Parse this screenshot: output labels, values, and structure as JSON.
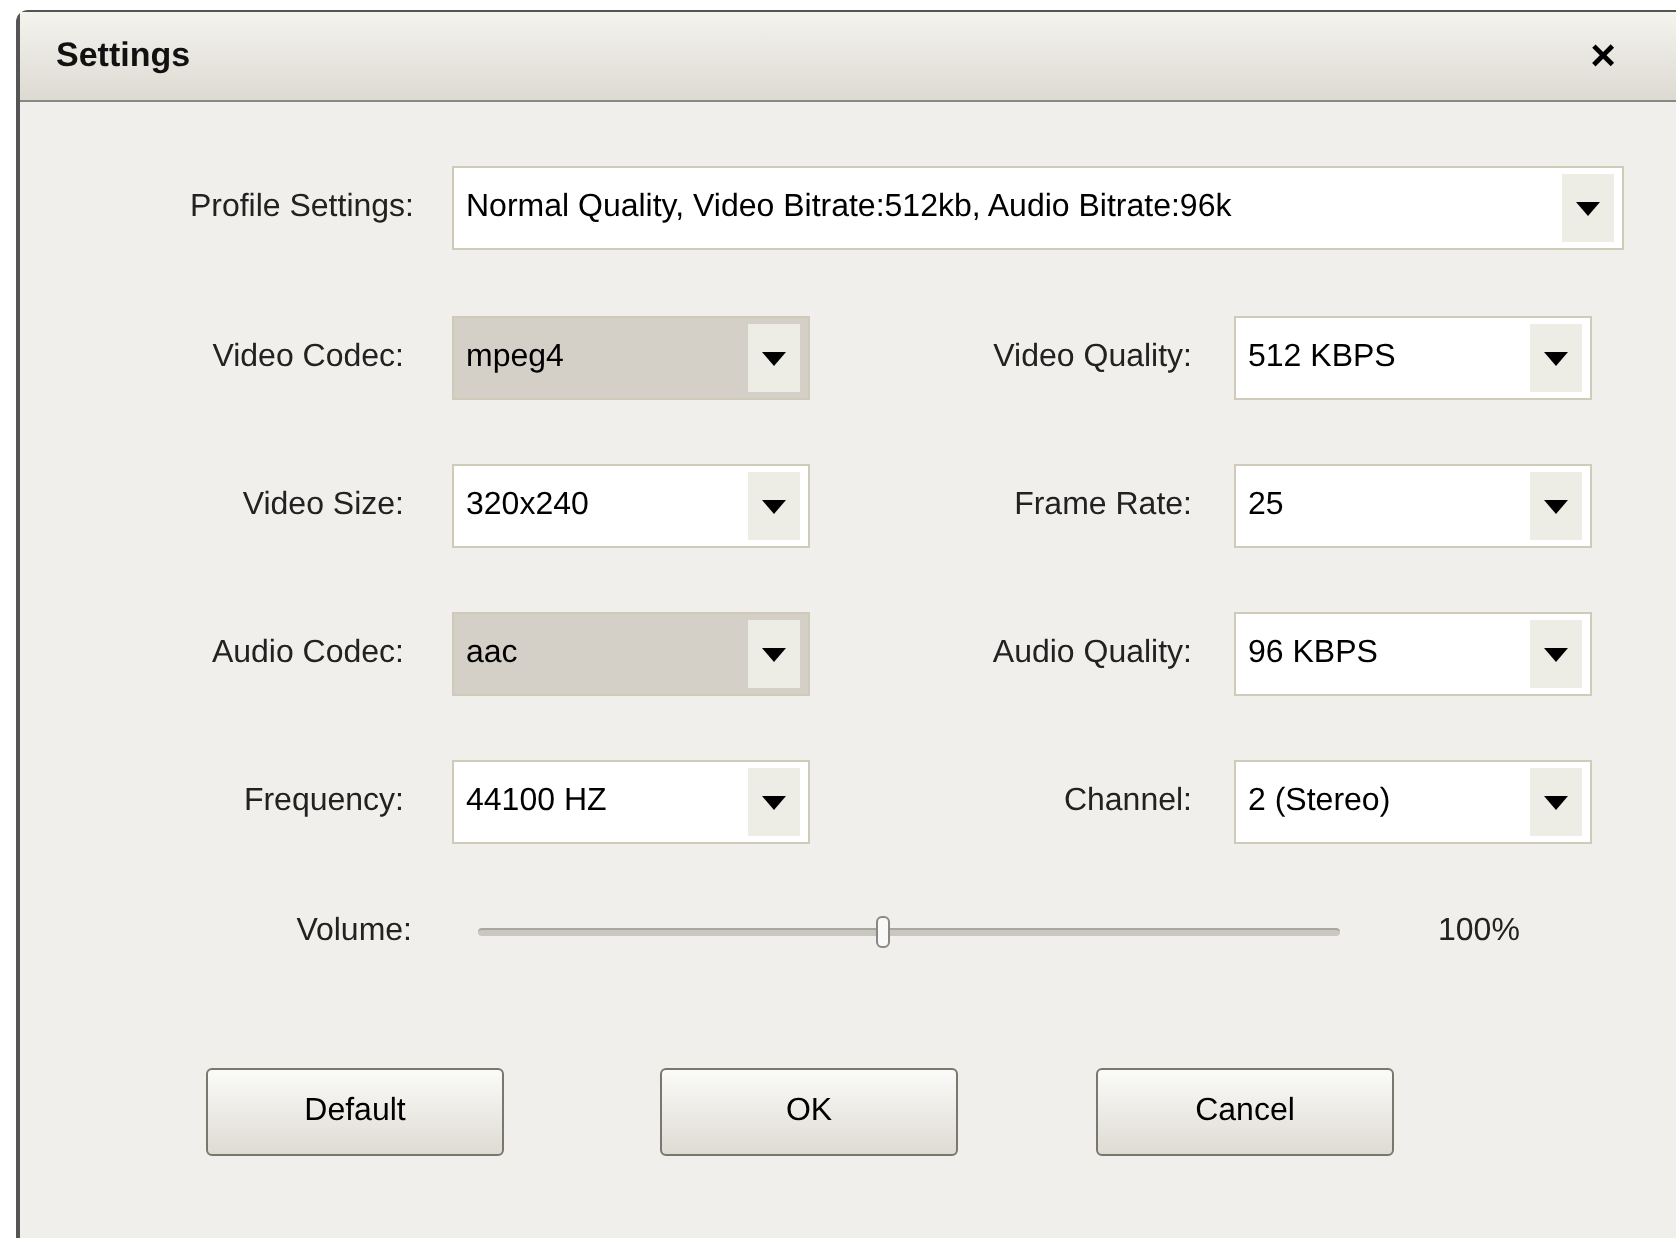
{
  "window": {
    "title": "Settings",
    "close": "×"
  },
  "profile": {
    "label": "Profile Settings:",
    "value": "Normal Quality, Video Bitrate:512kb, Audio Bitrate:96k",
    "disabled": false
  },
  "fields": [
    {
      "label": "Video Codec:",
      "value": "mpeg4",
      "disabled": true
    },
    {
      "label": "Video Quality:",
      "value": "512 KBPS",
      "disabled": false
    },
    {
      "label": "Video Size:",
      "value": "320x240",
      "disabled": false
    },
    {
      "label": "Frame Rate:",
      "value": "25",
      "disabled": false
    },
    {
      "label": "Audio Codec:",
      "value": "aac",
      "disabled": true
    },
    {
      "label": "Audio Quality:",
      "value": "96 KBPS",
      "disabled": false
    },
    {
      "label": "Frequency:",
      "value": "44100 HZ",
      "disabled": false
    },
    {
      "label": "Channel:",
      "value": "2 (Stereo)",
      "disabled": false
    }
  ],
  "volume": {
    "label": "Volume:",
    "level": 0.47,
    "reading": "100%"
  },
  "buttons": [
    "Default",
    "OK",
    "Cancel"
  ]
}
